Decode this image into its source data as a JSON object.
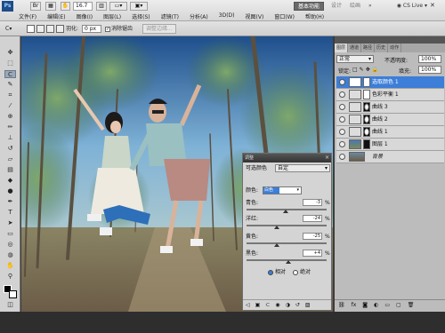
{
  "app": {
    "logo": "Ps",
    "zoom": "16.7",
    "workspace_active": "基本功能",
    "workspaces": [
      "设计",
      "绘画"
    ],
    "cs_live": "CS Live"
  },
  "menu": [
    "文件(F)",
    "编辑(E)",
    "图像(I)",
    "图层(L)",
    "选择(S)",
    "滤镜(T)",
    "分析(A)",
    "3D(D)",
    "视图(V)",
    "窗口(W)",
    "帮助(H)"
  ],
  "options": {
    "feather_label": "羽化:",
    "feather_value": "0 px",
    "antialias_label": "消除锯齿",
    "refine_btn": "调整边缘..."
  },
  "layers_panel": {
    "tabs": [
      "图层",
      "通道",
      "路径",
      "历史",
      "动作"
    ],
    "blend_mode": "正常",
    "opacity_label": "不透明度:",
    "opacity_value": "100%",
    "lock_label": "锁定:",
    "fill_label": "填充:",
    "fill_value": "100%",
    "layers": [
      {
        "name": "选取颜色 1",
        "selected": true
      },
      {
        "name": "色彩平衡 1",
        "selected": false
      },
      {
        "name": "曲线 3",
        "selected": false
      },
      {
        "name": "曲线 2",
        "selected": false
      },
      {
        "name": "曲线 1",
        "selected": false
      },
      {
        "name": "图层 1",
        "selected": false
      },
      {
        "name": "背景",
        "selected": false
      }
    ]
  },
  "adjustments": {
    "title": "调整",
    "subtitle": "可选颜色",
    "preset": "自定",
    "color_label": "颜色:",
    "color_value": "白色",
    "sliders": [
      {
        "label": "青色:",
        "value": "-3",
        "pct": "%",
        "pos": 0.485
      },
      {
        "label": "洋红:",
        "value": "-24",
        "pct": "%",
        "pos": 0.38
      },
      {
        "label": "黄色:",
        "value": "-25",
        "pct": "%",
        "pos": 0.375
      },
      {
        "label": "黑色:",
        "value": "+4",
        "pct": "%",
        "pos": 0.52
      }
    ],
    "relative": "相对",
    "absolute": "绝对"
  },
  "colors": {
    "accent": "#3c7ed8",
    "panel": "#bcbcbc",
    "chrome": "#d6d6d6"
  }
}
